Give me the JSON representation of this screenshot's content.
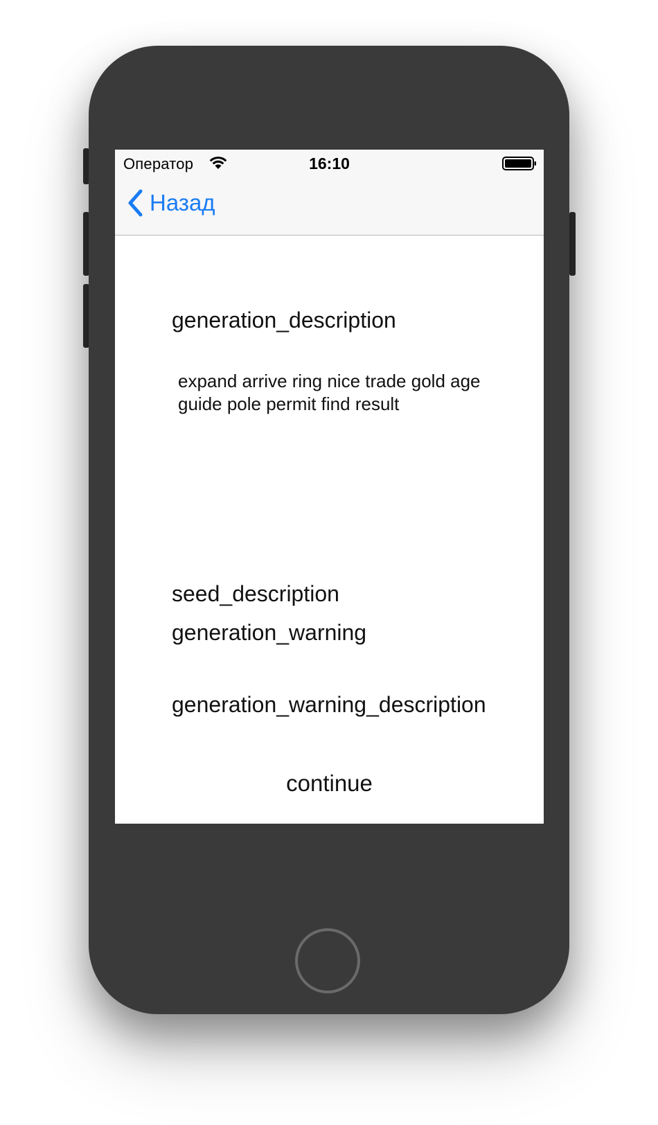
{
  "status_bar": {
    "carrier": "Оператор",
    "time": "16:10",
    "wifi_icon": "wifi-icon",
    "battery_icon": "battery-icon"
  },
  "nav": {
    "back_label": "Назад",
    "back_icon": "chevron-left-icon",
    "accent_color": "#1a7cf4"
  },
  "content": {
    "generation_description": "generation_description",
    "seed_words": "expand arrive ring nice trade gold age guide pole permit find result",
    "seed_description": "seed_description",
    "generation_warning": "generation_warning",
    "generation_warning_description": "generation_warning_description",
    "continue_label": "continue"
  },
  "device": {
    "home_button_icon": "home-button-icon"
  }
}
